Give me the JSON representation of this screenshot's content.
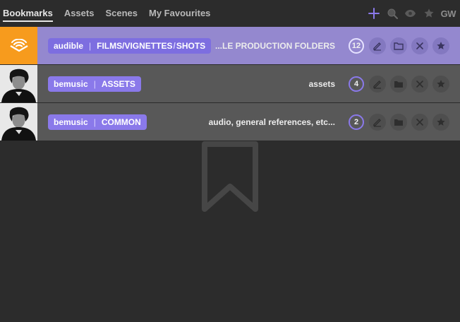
{
  "tabs": [
    {
      "label": "Bookmarks"
    },
    {
      "label": "Assets"
    },
    {
      "label": "Scenes"
    },
    {
      "label": "My Favourites"
    }
  ],
  "toolbar": {
    "add_icon": "plus-icon",
    "search_icon": "search-icon",
    "view_icon": "eye-icon",
    "favourite_icon": "star-icon",
    "user_initials": "GW"
  },
  "rows": [
    {
      "client": "audible",
      "path_1": "FILMS/VIGNETTES",
      "path_sep": "/",
      "path_2": "SHOTS",
      "description": "...LE PRODUCTION FOLDERS",
      "count": "12",
      "thumb": "audible-logo"
    },
    {
      "client": "bemusic",
      "path_1": "ASSETS",
      "description": "assets",
      "count": "4",
      "thumb": "portrait"
    },
    {
      "client": "bemusic",
      "path_1": "COMMON",
      "description": "audio, general references, etc...",
      "count": "2",
      "thumb": "portrait"
    }
  ],
  "colors": {
    "accent": "#8a79ea",
    "active_row": "#9488cf",
    "audible_orange": "#f79b1d",
    "background": "#2c2c2c"
  }
}
